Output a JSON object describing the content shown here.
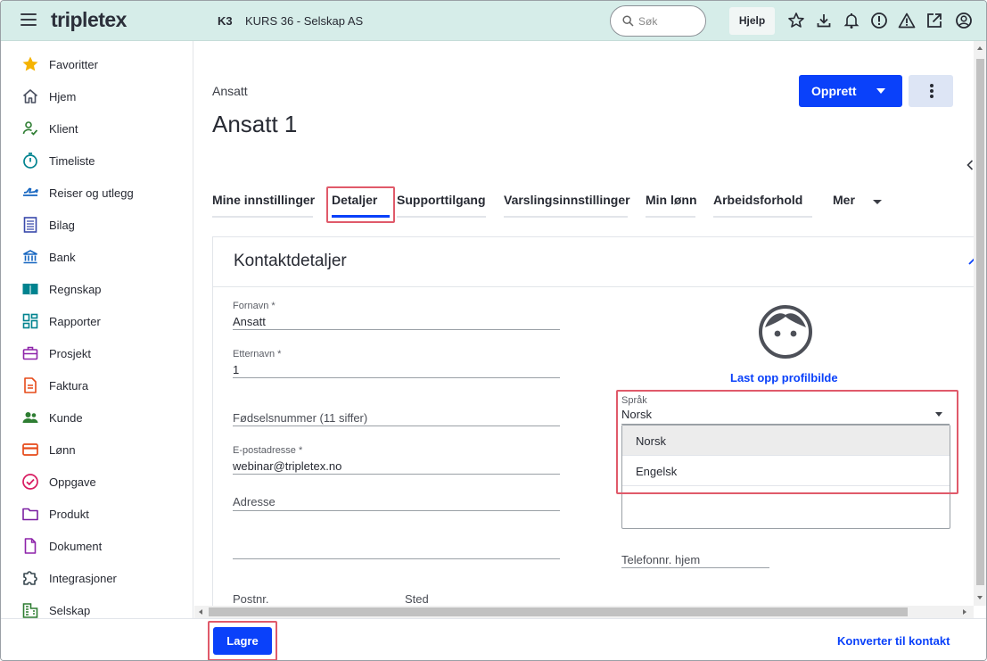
{
  "header": {
    "logo": "tripletex",
    "company_code": "K3",
    "company_name": "KURS 36 - Selskap AS",
    "search_placeholder": "Søk",
    "help_label": "Hjelp"
  },
  "sidebar": {
    "items": [
      {
        "label": "Favoritter",
        "icon": "star-icon"
      },
      {
        "label": "Hjem",
        "icon": "home-icon"
      },
      {
        "label": "Klient",
        "icon": "client-icon"
      },
      {
        "label": "Timeliste",
        "icon": "stopwatch-icon"
      },
      {
        "label": "Reiser og utlegg",
        "icon": "airplane-icon"
      },
      {
        "label": "Bilag",
        "icon": "voucher-icon"
      },
      {
        "label": "Bank",
        "icon": "bank-icon"
      },
      {
        "label": "Regnskap",
        "icon": "book-icon"
      },
      {
        "label": "Rapporter",
        "icon": "dashboard-icon"
      },
      {
        "label": "Prosjekt",
        "icon": "briefcase-icon"
      },
      {
        "label": "Faktura",
        "icon": "invoice-icon"
      },
      {
        "label": "Kunde",
        "icon": "customers-icon"
      },
      {
        "label": "Lønn",
        "icon": "payroll-card-icon"
      },
      {
        "label": "Oppgave",
        "icon": "task-check-icon"
      },
      {
        "label": "Produkt",
        "icon": "folder-icon"
      },
      {
        "label": "Dokument",
        "icon": "document-icon"
      },
      {
        "label": "Integrasjoner",
        "icon": "puzzle-icon"
      },
      {
        "label": "Selskap",
        "icon": "building-icon"
      }
    ]
  },
  "page": {
    "breadcrumb": "Ansatt",
    "title": "Ansatt 1",
    "create_label": "Opprett"
  },
  "tabs": [
    {
      "label": "Mine innstillinger",
      "active": false
    },
    {
      "label": "Detaljer",
      "active": true
    },
    {
      "label": "Supporttilgang",
      "active": false
    },
    {
      "label": "Varslingsinnstillinger",
      "active": false
    },
    {
      "label": "Min lønn",
      "active": false
    },
    {
      "label": "Arbeidsforhold",
      "active": false
    },
    {
      "label": "Mer",
      "active": false
    }
  ],
  "card": {
    "title": "Kontaktdetaljer",
    "fields": {
      "first_name": {
        "label": "Fornavn *",
        "value": "Ansatt"
      },
      "last_name": {
        "label": "Etternavn *",
        "value": "1"
      },
      "ssn": {
        "placeholder": "Fødselsnummer (11 siffer)"
      },
      "email": {
        "label": "E-postadresse *",
        "value": "webinar@tripletex.no"
      },
      "address": {
        "placeholder": "Adresse"
      },
      "postal_code": {
        "placeholder": "Postnr."
      },
      "city": {
        "placeholder": "Sted"
      },
      "home_phone": {
        "placeholder": "Telefonnr. hjem"
      }
    },
    "upload_label": "Last opp profilbilde",
    "language": {
      "label": "Språk",
      "value": "Norsk",
      "options": [
        "Norsk",
        "Engelsk"
      ]
    }
  },
  "footer": {
    "save_label": "Lagre",
    "convert_label": "Konverter til kontakt"
  },
  "colors": {
    "primary": "#0a41fa",
    "topbar": "#d6ede9",
    "highlight": "#e05a6a"
  }
}
